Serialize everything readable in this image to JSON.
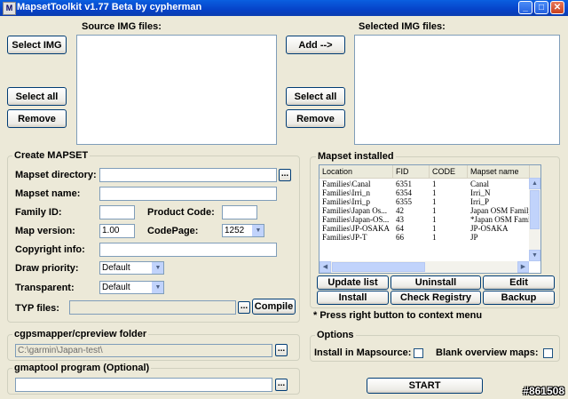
{
  "window": {
    "title": "MapsetToolkit v1.77 Beta by cypherman"
  },
  "source": {
    "header": "Source IMG files:",
    "select_img": "Select IMG",
    "select_all": "Select all",
    "remove": "Remove"
  },
  "selected": {
    "header": "Selected IMG files:",
    "add": "Add -->",
    "select_all": "Select all",
    "remove": "Remove"
  },
  "create": {
    "title": "Create MAPSET",
    "mapset_directory_label": "Mapset directory:",
    "mapset_name_label": "Mapset name:",
    "family_id_label": "Family ID:",
    "product_code_label": "Product Code:",
    "map_version_label": "Map version:",
    "map_version_value": "1.00",
    "codepage_label": "CodePage:",
    "codepage_value": "1252",
    "copyright_label": "Copyright info:",
    "draw_priority_label": "Draw priority:",
    "draw_priority_value": "Default",
    "transparent_label": "Transparent:",
    "transparent_value": "Default",
    "typ_label": "TYP files:",
    "browse": "...",
    "compile": "Compile"
  },
  "installed": {
    "title": "Mapset installed",
    "columns": [
      "Location",
      "FID",
      "CODE",
      "Mapset name"
    ],
    "rows": [
      [
        "Families\\Canal",
        "6351",
        "1",
        "Canal"
      ],
      [
        "Families\\Irri_n",
        "6354",
        "1",
        "Irri_N"
      ],
      [
        "Families\\Irri_p",
        "6355",
        "1",
        "Irri_P"
      ],
      [
        "Families\\Japan Os...",
        "42",
        "1",
        "Japan OSM Family"
      ],
      [
        "Families\\Japan-OS...",
        "43",
        "1",
        "*Japan OSM Family"
      ],
      [
        "Families\\JP-OSAKA",
        "64",
        "1",
        "JP-OSAKA"
      ],
      [
        "Families\\JP-T",
        "66",
        "1",
        "JP"
      ]
    ],
    "buttons": {
      "update_list": "Update list",
      "uninstall": "Uninstall",
      "edit": "Edit",
      "install": "Install",
      "check_registry": "Check Registry",
      "backup": "Backup"
    },
    "hint": "* Press right button to context menu"
  },
  "cgps": {
    "title": "cgpsmapper/cpreview folder",
    "value": "C:\\garmin\\Japan-test\\"
  },
  "gmaptool": {
    "title": "gmaptool program (Optional)"
  },
  "options": {
    "title": "Options",
    "install_label": "Install in Mapsource:",
    "blank_label": "Blank overview maps:"
  },
  "start": "START",
  "watermark": "#861508"
}
